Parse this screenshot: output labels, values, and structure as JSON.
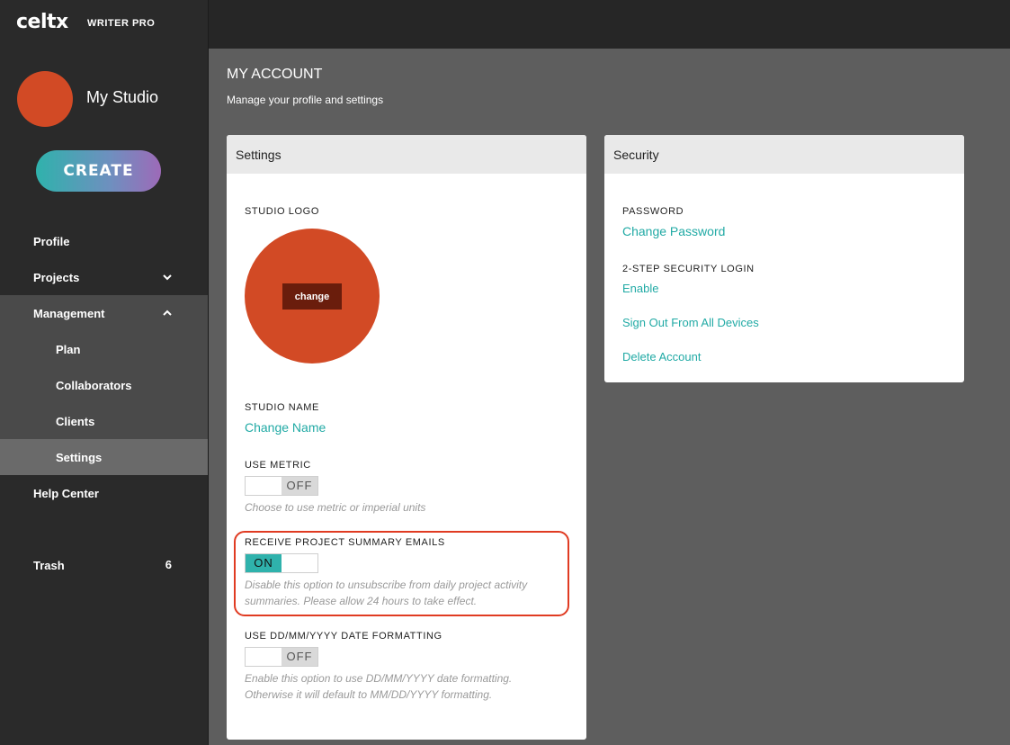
{
  "brand": {
    "logo_text": "celtx",
    "edition": "WRITER PRO"
  },
  "studio": {
    "name": "My Studio"
  },
  "sidebar": {
    "create_label": "CREATE",
    "items": [
      {
        "label": "Profile"
      },
      {
        "label": "Projects"
      },
      {
        "label": "Management"
      },
      {
        "label": "Plan"
      },
      {
        "label": "Collaborators"
      },
      {
        "label": "Clients"
      },
      {
        "label": "Settings"
      },
      {
        "label": "Help Center"
      },
      {
        "label": "Trash",
        "count": "6"
      }
    ]
  },
  "page": {
    "title": "MY ACCOUNT",
    "subtitle": "Manage your profile and settings"
  },
  "settings": {
    "header": "Settings",
    "studio_logo_label": "STUDIO LOGO",
    "change_button": "change",
    "studio_name_label": "STUDIO NAME",
    "change_name_link": "Change Name",
    "use_metric_label": "USE METRIC",
    "use_metric_state": "OFF",
    "use_metric_hint": "Choose to use metric or imperial units",
    "summary_emails_label": "RECEIVE PROJECT SUMMARY EMAILS",
    "summary_emails_state": "ON",
    "summary_emails_hint_1": "Disable this option to unsubscribe from daily project activity",
    "summary_emails_hint_2": "summaries. Please allow 24 hours to take effect.",
    "date_format_label": "USE DD/MM/YYYY DATE FORMATTING",
    "date_format_state": "OFF",
    "date_format_hint_1": "Enable this option to use DD/MM/YYYY date formatting.",
    "date_format_hint_2": "Otherwise it will default to MM/DD/YYYY formatting."
  },
  "security": {
    "header": "Security",
    "password_label": "PASSWORD",
    "change_password_link": "Change Password",
    "two_step_label": "2-STEP SECURITY LOGIN",
    "enable_link": "Enable",
    "sign_out_link": "Sign Out From All Devices",
    "delete_link": "Delete Account"
  },
  "colors": {
    "accent": "#21aaa5",
    "brand_orange": "#d24a25",
    "highlight": "#e03b22"
  }
}
